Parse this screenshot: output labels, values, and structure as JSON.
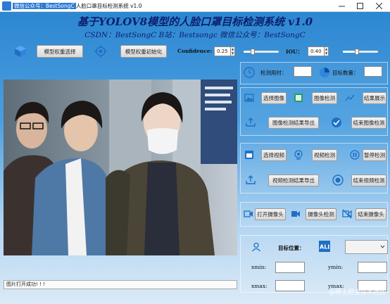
{
  "window": {
    "title_prefix": "微信公众号：BestSongC",
    "title_suffix": "人脸口罩目标检测系统 v1.0"
  },
  "header": {
    "title": "基于YOLOV8模型的人脸口罩目标检测系统 v1.0",
    "subtitle": "CSDN：BestSongC  B站：Bestsongc  微信公众号：BestSongC"
  },
  "toolbar": {
    "select_weights_label": "模型权重选择",
    "init_weights_label": "模型权重初始化",
    "confidence_label": "Confidence:",
    "confidence_value": "0.25",
    "confidence_level": 0.25,
    "iou_label": "IOU：",
    "iou_value": "0.40",
    "iou_level": 0.4
  },
  "stats": {
    "time_label": "检测用时：",
    "time_value": "",
    "count_label": "目标数量：",
    "count_value": ""
  },
  "image_section": {
    "select_image": "选择图像",
    "detect_image": "图像检测",
    "show_result": "结果展示",
    "export_image_result": "图像检测结果导出",
    "end_image_detect": "结束图像检测"
  },
  "video_section": {
    "select_video": "选择视频",
    "detect_video": "视频检测",
    "pause_detect": "暂停检测",
    "export_video_result": "视频检测结果导出",
    "end_video_detect": "结束视频检测"
  },
  "camera_section": {
    "open_camera": "打开摄像头",
    "camera_detect": "摄像头检测",
    "close_camera": "结束摄像头"
  },
  "position_section": {
    "target_position_label": "目标位置：",
    "select_value": "",
    "xmin_label": "xmin:",
    "ymin_label": "ymin:",
    "xmax_label": "xmax:",
    "ymax_label": "ymax:",
    "xmin_value": "",
    "ymin_value": "",
    "xmax_value": "",
    "ymax_value": ""
  },
  "status": {
    "message": "图片打开成功! ! !"
  },
  "watermark": "@稀土掘金技术社区",
  "colors": {
    "accent": "#2b7bd6",
    "title_text": "#0b1f6e"
  }
}
